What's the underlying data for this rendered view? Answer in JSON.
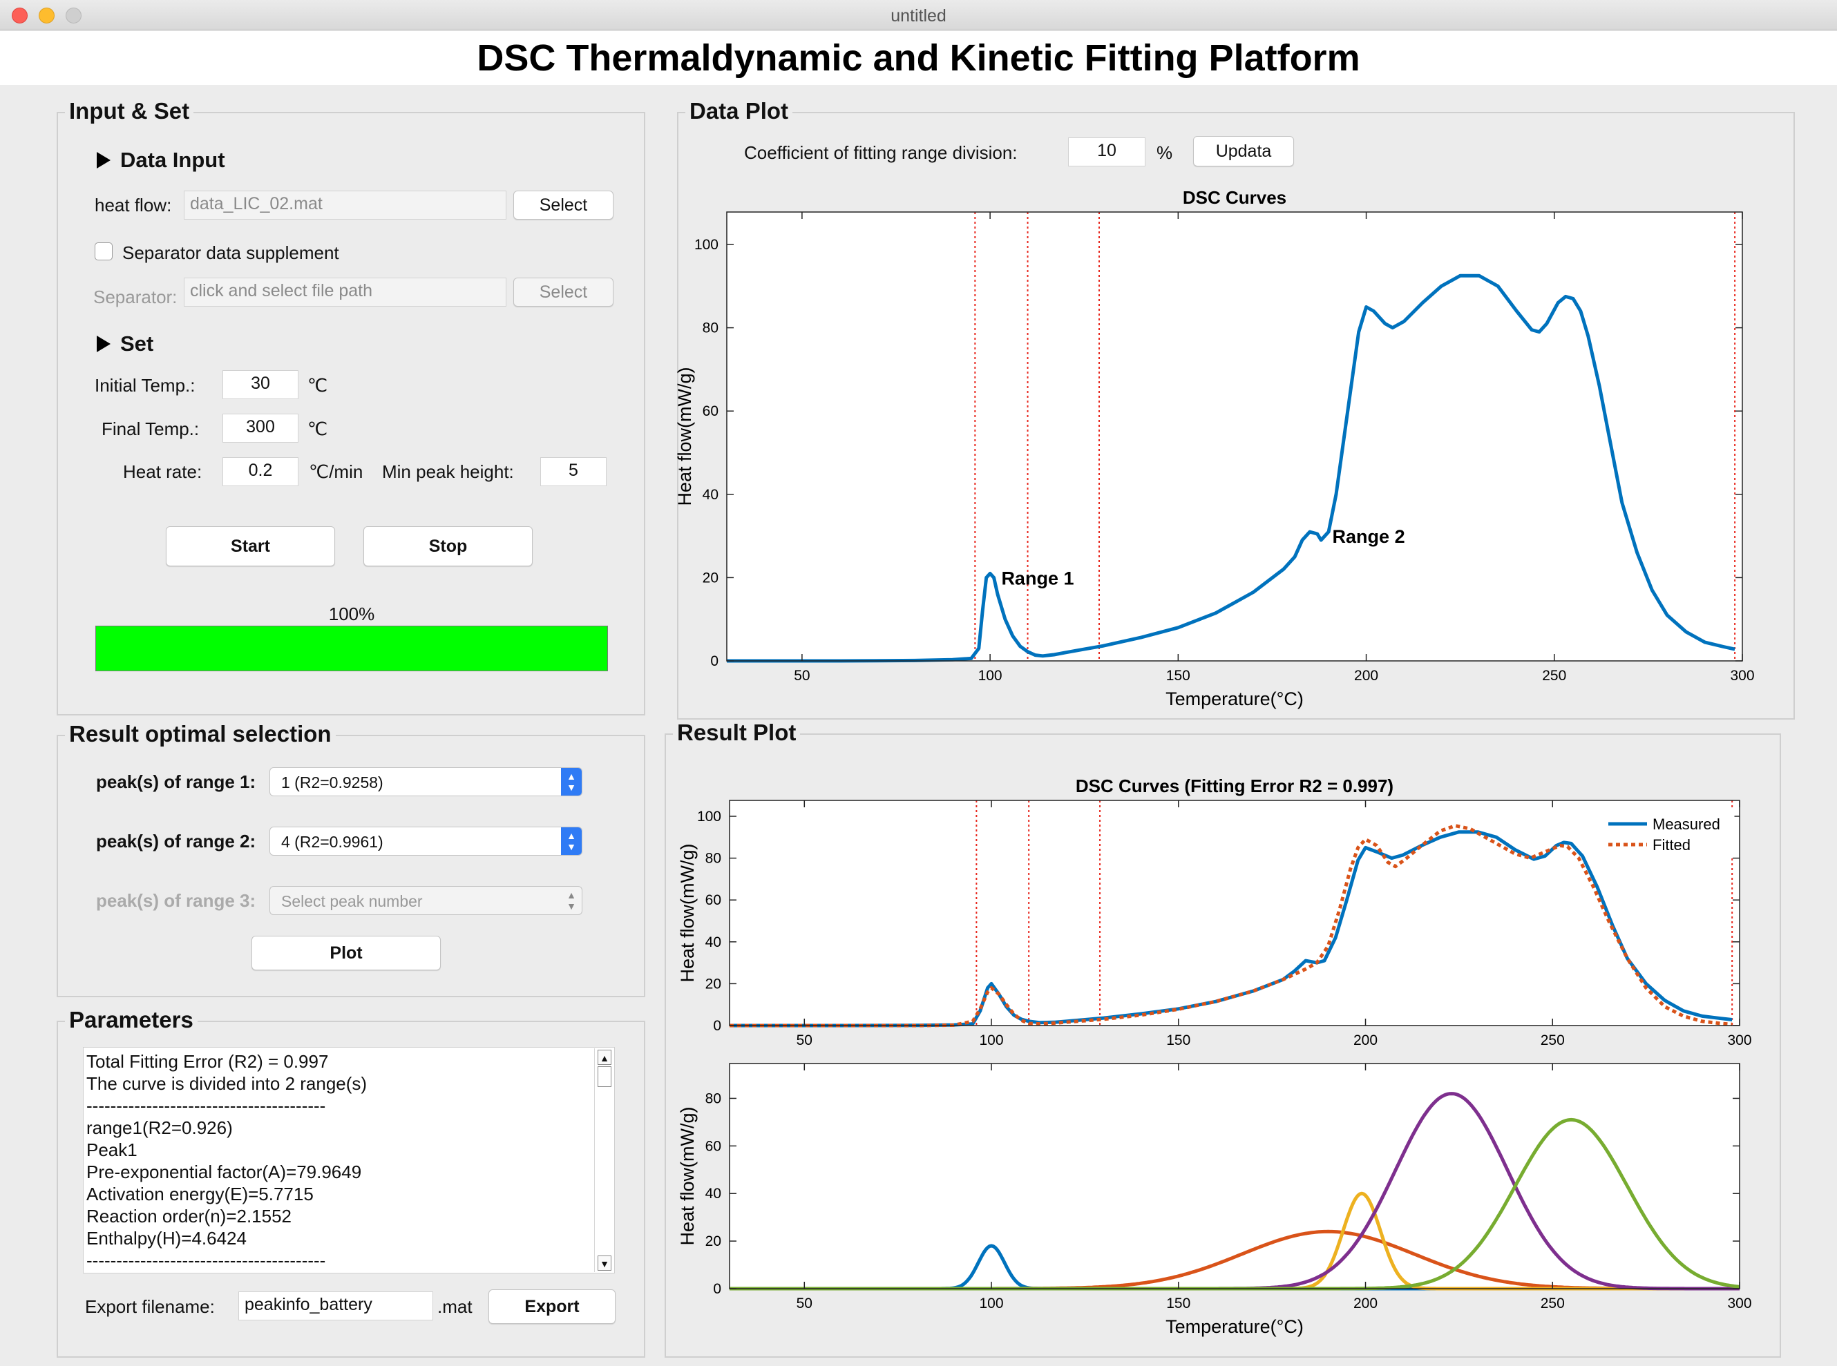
{
  "window": {
    "title": "untitled"
  },
  "app": {
    "title": "DSC Thermaldynamic and Kinetic Fitting Platform"
  },
  "input_panel": {
    "title": "Input & Set",
    "data_input": {
      "heading": "Data Input",
      "heat_flow_label": "heat flow:",
      "heat_flow_value": "data_LIC_02.mat",
      "select_label": "Select",
      "separator_checkbox_label": "Separator data supplement",
      "separator_checked": false,
      "separator_label": "Separator:",
      "separator_placeholder": "click and select file path",
      "separator_select_label": "Select"
    },
    "set": {
      "heading": "Set",
      "initial_temp_label": "Initial Temp.:",
      "initial_temp_value": "30",
      "initial_temp_unit": "℃",
      "final_temp_label": "Final Temp.:",
      "final_temp_value": "300",
      "final_temp_unit": "℃",
      "heat_rate_label": "Heat rate:",
      "heat_rate_value": "0.2",
      "heat_rate_unit": "℃/min",
      "min_peak_label": "Min peak height:",
      "min_peak_value": "5"
    },
    "start_label": "Start",
    "stop_label": "Stop",
    "progress_text": "100%",
    "progress_value": 1.0,
    "progress_color": "#00ff00"
  },
  "result_selection": {
    "title": "Result optimal selection",
    "range1_label": "peak(s) of range 1:",
    "range1_value": "1 (R2=0.9258)",
    "range2_label": "peak(s) of range 2:",
    "range2_value": "4 (R2=0.9961)",
    "range3_label": "peak(s) of range 3:",
    "range3_value": "Select peak number",
    "plot_label": "Plot"
  },
  "parameters": {
    "title": "Parameters",
    "lines": [
      "Total Fitting Error (R2) = 0.997",
      "The curve is divided into 2 range(s)",
      "----------------------------------------",
      "range1(R2=0.926)",
      "Peak1",
      "Pre-exponential factor(A)=79.9649",
      "Activation energy(E)=5.7715",
      "Reaction order(n)=2.1552",
      "Enthalpy(H)=4.6424",
      "----------------------------------------"
    ],
    "export_label": "Export filename:",
    "export_value": "peakinfo_battery",
    "export_ext": ".mat",
    "export_button": "Export"
  },
  "data_plot": {
    "title": "Data Plot",
    "coef_label": "Coefficient of fitting range division:",
    "coef_value": "10",
    "coef_unit": "%",
    "update_label": "Updata"
  },
  "result_plot": {
    "title": "Result Plot"
  },
  "colors": {
    "measured": "#0072bd",
    "fitted": "#d95319",
    "range_line": "#e8281e",
    "peak1": "#0072bd",
    "peak2": "#d95319",
    "peak3": "#edb120",
    "peak4": "#7e2f8e",
    "peak5": "#77ac30"
  },
  "chart_data": [
    {
      "id": "dsc",
      "type": "line",
      "title": "DSC Curves",
      "xlabel": "Temperature(°C)",
      "ylabel": "Heat flow(mW/g)",
      "xlim": [
        30,
        300
      ],
      "ylim": [
        0,
        100
      ],
      "xticks": [
        50,
        100,
        150,
        200,
        250,
        300
      ],
      "yticks": [
        0,
        20,
        40,
        60,
        80,
        100
      ],
      "range_lines": [
        96,
        110,
        129,
        298
      ],
      "annotations": [
        {
          "text": "Range 1",
          "x": 103,
          "y": 20
        },
        {
          "text": "Range 2",
          "x": 191,
          "y": 30
        }
      ],
      "series": [
        {
          "name": "",
          "points": [
            [
              30,
              0
            ],
            [
              60,
              0
            ],
            [
              80,
              0.1
            ],
            [
              90,
              0.3
            ],
            [
              95,
              0.6
            ],
            [
              97,
              3
            ],
            [
              98,
              12
            ],
            [
              99,
              20
            ],
            [
              100,
              21
            ],
            [
              101,
              20
            ],
            [
              102,
              16
            ],
            [
              104,
              10
            ],
            [
              106,
              6
            ],
            [
              108,
              3.5
            ],
            [
              110,
              2.2
            ],
            [
              112,
              1.4
            ],
            [
              114,
              1.2
            ],
            [
              117,
              1.5
            ],
            [
              120,
              2
            ],
            [
              125,
              2.8
            ],
            [
              130,
              3.6
            ],
            [
              140,
              5.6
            ],
            [
              150,
              8
            ],
            [
              160,
              11.5
            ],
            [
              170,
              16.5
            ],
            [
              178,
              22
            ],
            [
              181,
              25
            ],
            [
              183,
              29
            ],
            [
              185,
              31
            ],
            [
              187,
              30.5
            ],
            [
              188,
              29
            ],
            [
              190,
              31
            ],
            [
              192,
              40
            ],
            [
              194,
              53
            ],
            [
              196,
              66
            ],
            [
              198,
              79
            ],
            [
              200,
              85
            ],
            [
              202,
              84
            ],
            [
              205,
              81
            ],
            [
              207,
              80
            ],
            [
              210,
              81.5
            ],
            [
              215,
              86
            ],
            [
              220,
              90
            ],
            [
              225,
              92.5
            ],
            [
              230,
              92.5
            ],
            [
              235,
              90
            ],
            [
              240,
              84
            ],
            [
              244,
              79.5
            ],
            [
              246,
              79
            ],
            [
              248,
              81
            ],
            [
              251,
              86
            ],
            [
              253,
              87.5
            ],
            [
              255,
              87
            ],
            [
              257,
              84
            ],
            [
              259,
              78
            ],
            [
              262,
              66
            ],
            [
              265,
              52
            ],
            [
              268,
              38
            ],
            [
              272,
              26
            ],
            [
              276,
              17
            ],
            [
              280,
              11
            ],
            [
              285,
              7
            ],
            [
              290,
              4.5
            ],
            [
              295,
              3.4
            ],
            [
              298,
              2.8
            ]
          ]
        }
      ]
    },
    {
      "id": "fit",
      "type": "line",
      "title": "DSC Curves (Fitting Error R2 = 0.997)",
      "xlabel": "",
      "ylabel": "Heat flow(mW/g)",
      "xlim": [
        30,
        300
      ],
      "ylim": [
        0,
        100
      ],
      "xticks": [
        50,
        100,
        150,
        200,
        250,
        300
      ],
      "yticks": [
        0,
        20,
        40,
        60,
        80,
        100
      ],
      "range_lines": [
        96,
        110,
        129,
        298
      ],
      "legend": "top-right",
      "series": [
        {
          "name": "Measured",
          "points": [
            [
              30,
              0
            ],
            [
              60,
              0
            ],
            [
              80,
              0.1
            ],
            [
              90,
              0.3
            ],
            [
              95,
              0.8
            ],
            [
              97,
              7
            ],
            [
              99,
              18
            ],
            [
              100,
              20
            ],
            [
              102,
              15
            ],
            [
              104,
              9
            ],
            [
              106,
              5
            ],
            [
              108,
              3
            ],
            [
              110,
              2
            ],
            [
              113,
              1.4
            ],
            [
              117,
              1.6
            ],
            [
              120,
              2
            ],
            [
              130,
              3.6
            ],
            [
              140,
              5.6
            ],
            [
              150,
              8
            ],
            [
              160,
              11.5
            ],
            [
              170,
              16.5
            ],
            [
              178,
              22
            ],
            [
              181,
              26
            ],
            [
              184,
              31
            ],
            [
              187,
              30
            ],
            [
              189,
              31
            ],
            [
              192,
              42
            ],
            [
              195,
              60
            ],
            [
              198,
              79
            ],
            [
              200,
              85
            ],
            [
              203,
              83
            ],
            [
              207,
              80
            ],
            [
              210,
              81.5
            ],
            [
              215,
              86
            ],
            [
              220,
              90
            ],
            [
              225,
              92.5
            ],
            [
              230,
              92.5
            ],
            [
              235,
              90
            ],
            [
              240,
              84
            ],
            [
              245,
              79.5
            ],
            [
              248,
              81
            ],
            [
              251,
              86
            ],
            [
              253,
              87.5
            ],
            [
              255,
              87
            ],
            [
              258,
              81
            ],
            [
              262,
              66
            ],
            [
              266,
              48
            ],
            [
              270,
              32
            ],
            [
              275,
              20
            ],
            [
              280,
              12
            ],
            [
              285,
              7
            ],
            [
              290,
              4.5
            ],
            [
              295,
              3.4
            ],
            [
              298,
              2.8
            ]
          ]
        },
        {
          "name": "Fitted",
          "points": [
            [
              30,
              0
            ],
            [
              60,
              0
            ],
            [
              80,
              0
            ],
            [
              90,
              0.2
            ],
            [
              95,
              2
            ],
            [
              97,
              8
            ],
            [
              99,
              16
            ],
            [
              100,
              18
            ],
            [
              102,
              15
            ],
            [
              104,
              10
            ],
            [
              106,
              5.5
            ],
            [
              108,
              2.5
            ],
            [
              110,
              1
            ],
            [
              113,
              0.8
            ],
            [
              117,
              1.2
            ],
            [
              120,
              1.6
            ],
            [
              130,
              3
            ],
            [
              140,
              5
            ],
            [
              150,
              7.8
            ],
            [
              160,
              11.5
            ],
            [
              170,
              16.5
            ],
            [
              178,
              22
            ],
            [
              181,
              24.5
            ],
            [
              184,
              27
            ],
            [
              187,
              30
            ],
            [
              190,
              38
            ],
            [
              193,
              55
            ],
            [
              196,
              75
            ],
            [
              198,
              85
            ],
            [
              200,
              89
            ],
            [
              203,
              86
            ],
            [
              206,
              78
            ],
            [
              208,
              76
            ],
            [
              211,
              80
            ],
            [
              215,
              86
            ],
            [
              220,
              93
            ],
            [
              224,
              95.5
            ],
            [
              228,
              94
            ],
            [
              232,
              90
            ],
            [
              236,
              86
            ],
            [
              240,
              82
            ],
            [
              244,
              80
            ],
            [
              248,
              83
            ],
            [
              252,
              86
            ],
            [
              254,
              85.5
            ],
            [
              257,
              80
            ],
            [
              261,
              66
            ],
            [
              265,
              50
            ],
            [
              270,
              32
            ],
            [
              275,
              18
            ],
            [
              280,
              9
            ],
            [
              285,
              4.5
            ],
            [
              290,
              2
            ],
            [
              295,
              1
            ],
            [
              298,
              0.6
            ]
          ]
        }
      ]
    },
    {
      "id": "peaks",
      "type": "line",
      "title": "",
      "xlabel": "Temperature(°C)",
      "ylabel": "Heat flow(mW/g)",
      "xlim": [
        30,
        300
      ],
      "ylim": [
        0,
        90
      ],
      "xticks": [
        50,
        100,
        150,
        200,
        250,
        300
      ],
      "yticks": [
        0,
        20,
        40,
        60,
        80
      ],
      "series": [
        {
          "name": "",
          "peak": {
            "center": 100,
            "height": 18,
            "width": 3.5
          }
        },
        {
          "name": "",
          "peak": {
            "center": 190,
            "height": 24,
            "width": 23
          }
        },
        {
          "name": "",
          "peak": {
            "center": 199,
            "height": 40,
            "width": 5
          }
        },
        {
          "name": "",
          "peak": {
            "center": 223,
            "height": 82,
            "width": 15
          }
        },
        {
          "name": "",
          "peak": {
            "center": 255,
            "height": 71,
            "width": 15
          }
        }
      ]
    }
  ]
}
